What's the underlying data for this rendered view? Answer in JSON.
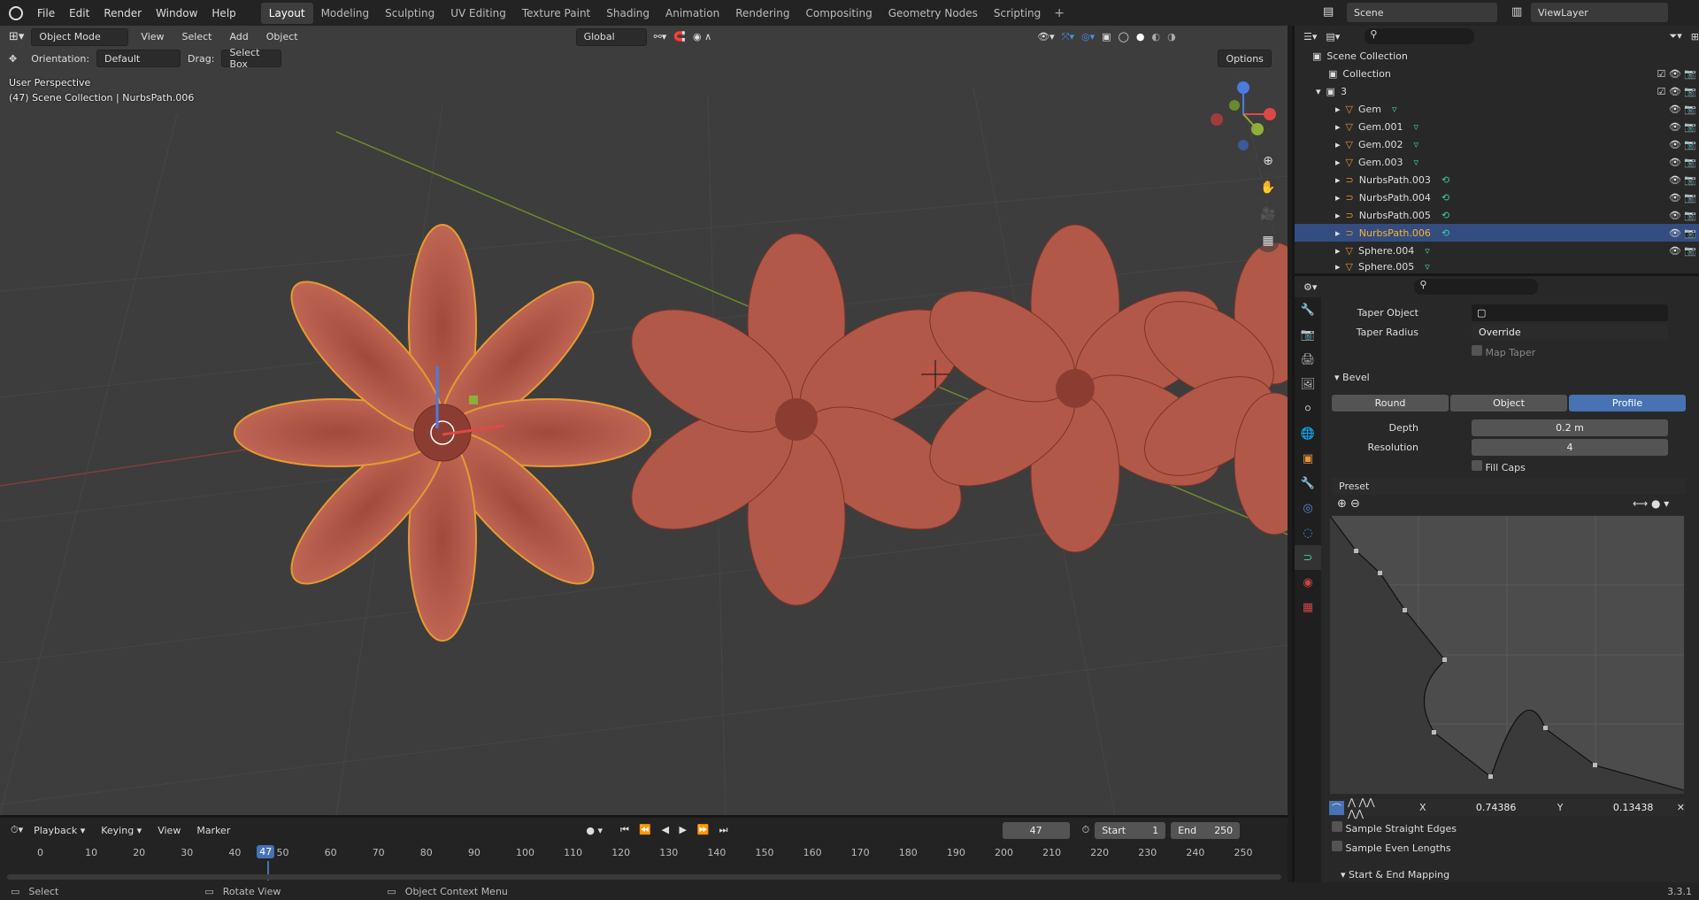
{
  "menu": [
    "File",
    "Edit",
    "Render",
    "Window",
    "Help"
  ],
  "workspaces": [
    "Layout",
    "Modeling",
    "Sculpting",
    "UV Editing",
    "Texture Paint",
    "Shading",
    "Animation",
    "Rendering",
    "Compositing",
    "Geometry Nodes",
    "Scripting"
  ],
  "active_workspace": "Layout",
  "scene": "Scene",
  "view_layer": "ViewLayer",
  "viewport": {
    "mode": "Object Mode",
    "menus": [
      "View",
      "Select",
      "Add",
      "Object"
    ],
    "transform": "Global",
    "orientation_label": "Orientation:",
    "orientation": "Default",
    "drag_label": "Drag:",
    "drag": "Select Box",
    "options": "Options",
    "perspective": "User Perspective",
    "context": "(47) Scene Collection | NurbsPath.006"
  },
  "outliner": {
    "root": "Scene Collection",
    "items": [
      {
        "name": "Collection",
        "type": "collection"
      },
      {
        "name": "3",
        "type": "collection"
      },
      {
        "name": "Gem",
        "type": "mesh"
      },
      {
        "name": "Gem.001",
        "type": "mesh"
      },
      {
        "name": "Gem.002",
        "type": "mesh"
      },
      {
        "name": "Gem.003",
        "type": "mesh"
      },
      {
        "name": "NurbsPath.003",
        "type": "curve"
      },
      {
        "name": "NurbsPath.004",
        "type": "curve"
      },
      {
        "name": "NurbsPath.005",
        "type": "curve"
      },
      {
        "name": "NurbsPath.006",
        "type": "curve",
        "selected": true
      },
      {
        "name": "Sphere.004",
        "type": "mesh"
      },
      {
        "name": "Sphere.005",
        "type": "mesh"
      }
    ]
  },
  "properties": {
    "taper_object_label": "Taper Object",
    "taper_radius_label": "Taper Radius",
    "taper_radius": "Override",
    "map_taper": "Map Taper",
    "bevel_header": "Bevel",
    "bevel_modes": [
      "Round",
      "Object",
      "Profile"
    ],
    "bevel_active": "Profile",
    "depth_label": "Depth",
    "depth": "0.2 m",
    "resolution_label": "Resolution",
    "resolution": "4",
    "fill_caps": "Fill Caps",
    "preset": "Preset",
    "x_label": "X",
    "x_value": "0.74386",
    "y_label": "Y",
    "y_value": "0.13438",
    "sample_straight": "Sample Straight Edges",
    "sample_even": "Sample Even Lengths",
    "start_end": "Start & End Mapping"
  },
  "timeline": {
    "menus": [
      "Playback",
      "Keying",
      "View",
      "Marker"
    ],
    "current_frame": "47",
    "start_label": "Start",
    "start": "1",
    "end_label": "End",
    "end": "250",
    "ticks": [
      "0",
      "10",
      "20",
      "30",
      "40",
      "50",
      "60",
      "70",
      "80",
      "90",
      "100",
      "110",
      "120",
      "130",
      "140",
      "150",
      "160",
      "170",
      "180",
      "190",
      "200",
      "210",
      "220",
      "230",
      "240",
      "250"
    ]
  },
  "status": {
    "select": "Select",
    "rotate": "Rotate View",
    "context_menu": "Object Context Menu",
    "version": "3.3.1"
  },
  "colors": {
    "accent": "#4772b3",
    "selected_outline": "#ffaf29",
    "flower": "#b85a4a"
  }
}
